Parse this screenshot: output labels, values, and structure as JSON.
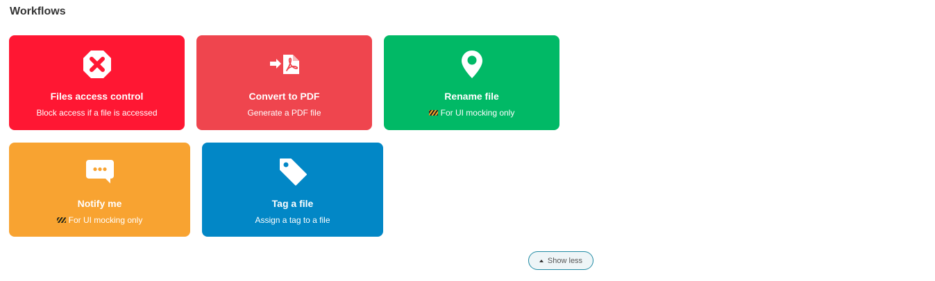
{
  "section": {
    "title": "Workflows"
  },
  "cards": [
    {
      "title": "Files access control",
      "subtitle": "Block access if a file is accessed",
      "color": "#ff1733",
      "icon": "octagon-x-icon"
    },
    {
      "title": "Convert to PDF",
      "subtitle": "Generate a PDF file",
      "color": "#ef454e",
      "icon": "convert-pdf-icon"
    },
    {
      "title": "Rename file",
      "subtitle": "For UI mocking only",
      "color": "#01b966",
      "icon": "map-pin-icon"
    },
    {
      "title": "Notify me",
      "subtitle": "For UI mocking only",
      "color": "#f8a331",
      "icon": "chat-bubble-icon"
    },
    {
      "title": "Tag a file",
      "subtitle": "Assign a tag to a file",
      "color": "#0287c6",
      "icon": "tag-icon"
    }
  ],
  "show_less": {
    "label": "Show less"
  }
}
